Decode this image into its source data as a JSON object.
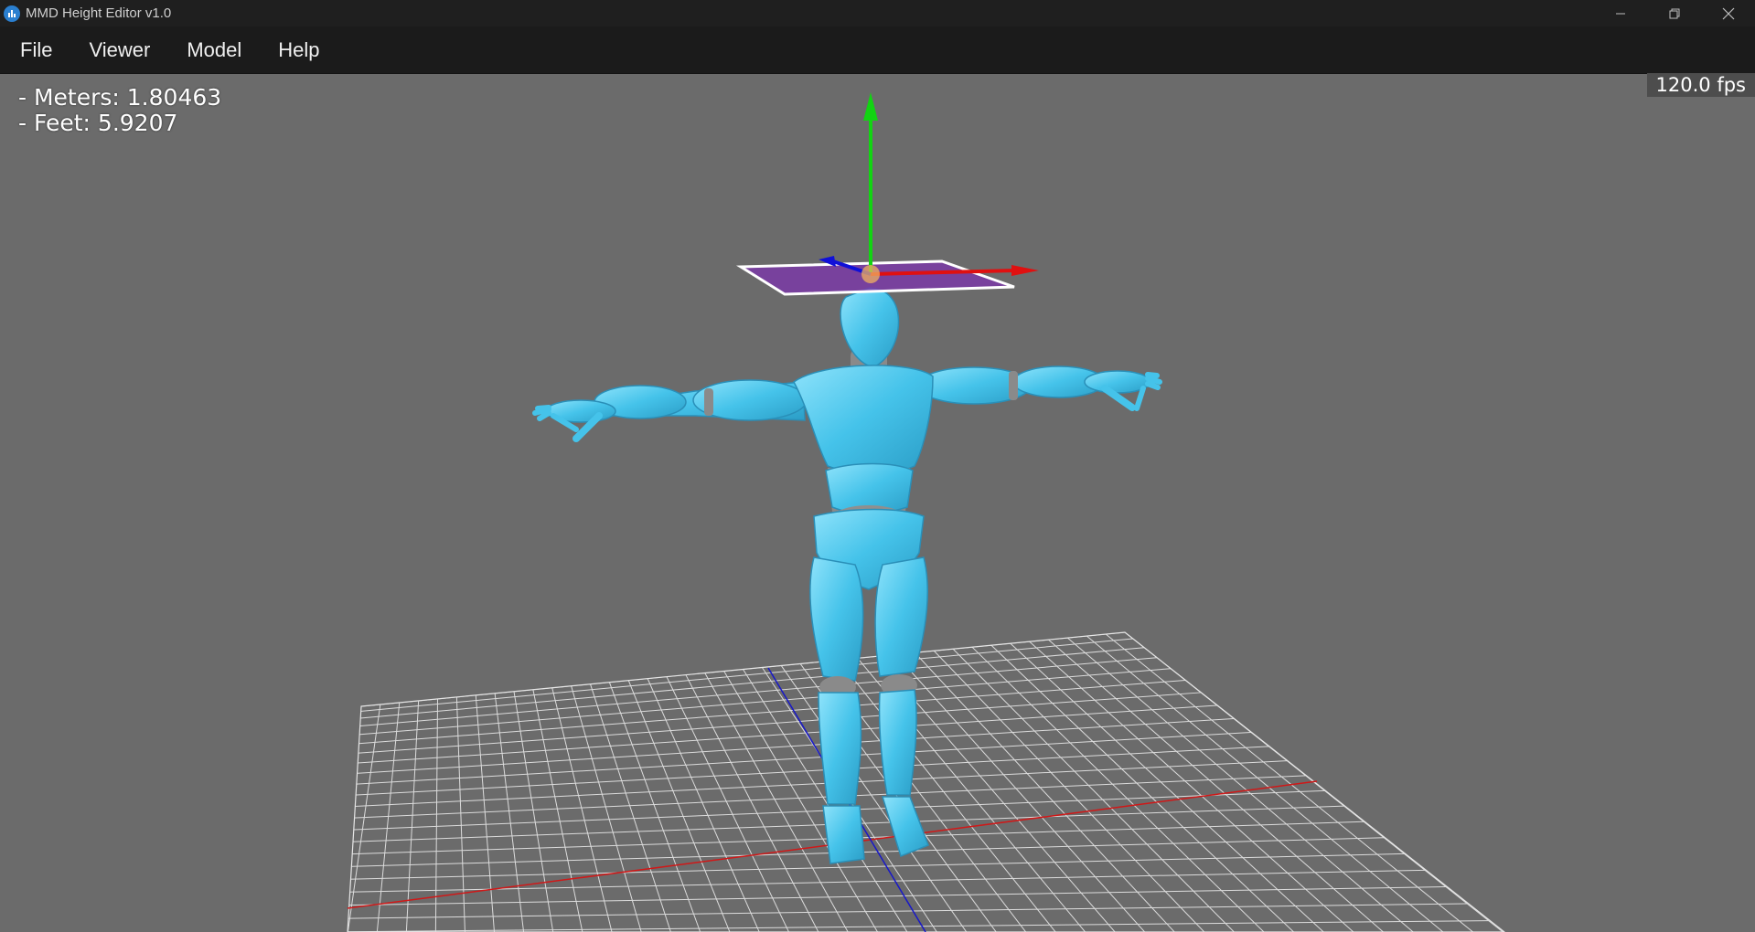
{
  "window": {
    "title": "MMD Height Editor v1.0",
    "icon": "app-logo-icon",
    "controls": [
      "minimize-icon",
      "restore-icon",
      "close-icon"
    ]
  },
  "menu": {
    "file": "File",
    "viewer": "Viewer",
    "model": "Model",
    "help": "Help"
  },
  "readout": {
    "meters": "- Meters: 1.80463",
    "feet": "- Feet: 5.9207"
  },
  "fps": "120.0 fps",
  "colors": {
    "background": "#6b6b6b",
    "model": "#45c3ea",
    "axis_x": "#e01010",
    "axis_y": "#12d412",
    "axis_z": "#1010d8",
    "plane": "#7a3aa6"
  }
}
